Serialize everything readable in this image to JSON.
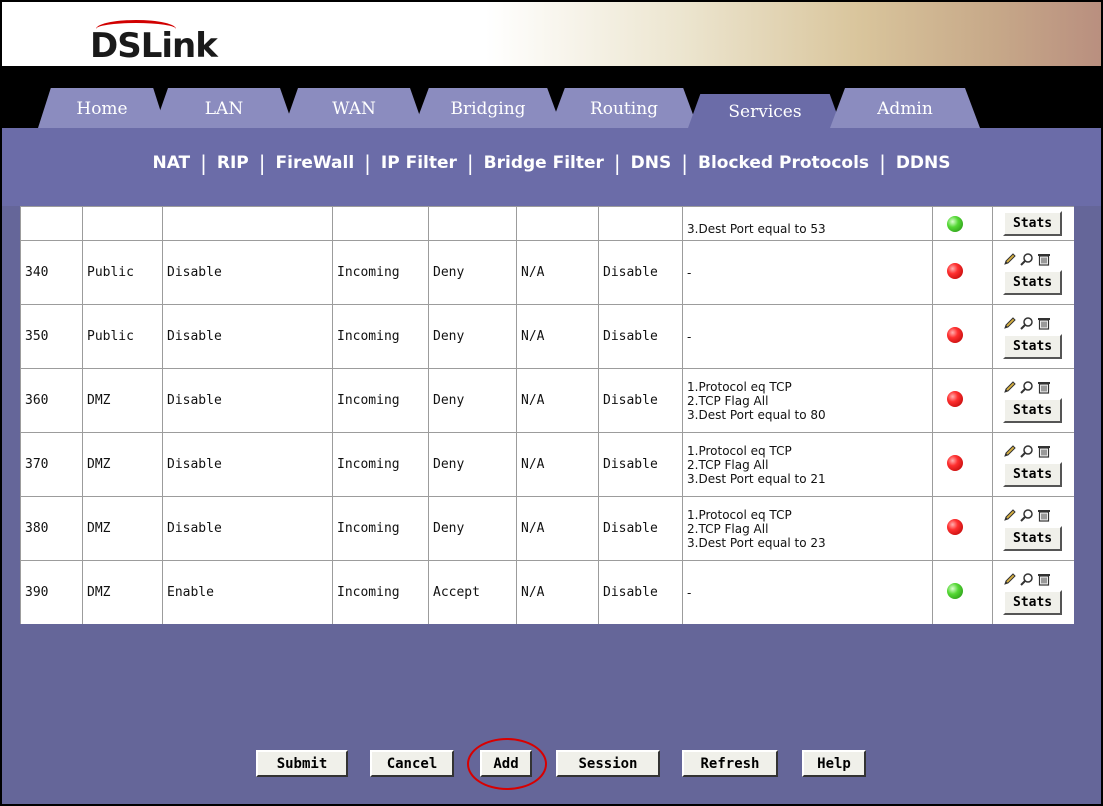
{
  "brand": {
    "logo_text": "DSLink"
  },
  "tabs": [
    {
      "label": "Home"
    },
    {
      "label": "LAN"
    },
    {
      "label": "WAN"
    },
    {
      "label": "Bridging"
    },
    {
      "label": "Routing"
    },
    {
      "label": "Services",
      "active": true
    },
    {
      "label": "Admin"
    }
  ],
  "subnav": [
    {
      "label": "NAT"
    },
    {
      "label": "RIP"
    },
    {
      "label": "FireWall"
    },
    {
      "label": "IP Filter"
    },
    {
      "label": "Bridge Filter"
    },
    {
      "label": "DNS"
    },
    {
      "label": "Blocked Protocols"
    },
    {
      "label": "DDNS"
    }
  ],
  "subnav_separator": "|",
  "partial_row": {
    "filter_tail": "3.Dest Port equal to 53",
    "status": "green",
    "stats_label": "Stats"
  },
  "rows": [
    {
      "id": "340",
      "interface": "Public",
      "enable": "Disable",
      "direction": "Incoming",
      "action": "Deny",
      "a": "N/A",
      "b": "Disable",
      "filter": "-",
      "status": "red",
      "stats_label": "Stats"
    },
    {
      "id": "350",
      "interface": "Public",
      "enable": "Disable",
      "direction": "Incoming",
      "action": "Deny",
      "a": "N/A",
      "b": "Disable",
      "filter": "-",
      "status": "red",
      "stats_label": "Stats"
    },
    {
      "id": "360",
      "interface": "DMZ",
      "enable": "Disable",
      "direction": "Incoming",
      "action": "Deny",
      "a": "N/A",
      "b": "Disable",
      "filter": "1.Protocol eq TCP\n2.TCP Flag All\n3.Dest Port equal to 80",
      "status": "red",
      "stats_label": "Stats"
    },
    {
      "id": "370",
      "interface": "DMZ",
      "enable": "Disable",
      "direction": "Incoming",
      "action": "Deny",
      "a": "N/A",
      "b": "Disable",
      "filter": "1.Protocol eq TCP\n2.TCP Flag All\n3.Dest Port equal to 21",
      "status": "red",
      "stats_label": "Stats"
    },
    {
      "id": "380",
      "interface": "DMZ",
      "enable": "Disable",
      "direction": "Incoming",
      "action": "Deny",
      "a": "N/A",
      "b": "Disable",
      "filter": "1.Protocol eq TCP\n2.TCP Flag All\n3.Dest Port equal to 23",
      "status": "red",
      "stats_label": "Stats"
    },
    {
      "id": "390",
      "interface": "DMZ",
      "enable": "Enable",
      "direction": "Incoming",
      "action": "Accept",
      "a": "N/A",
      "b": "Disable",
      "filter": "-",
      "status": "green",
      "stats_label": "Stats"
    }
  ],
  "row_icons": [
    "edit-pencil-icon",
    "view-magnifier-icon",
    "delete-trash-icon"
  ],
  "buttons": {
    "submit": "Submit",
    "cancel": "Cancel",
    "add": "Add",
    "session": "Session",
    "refresh": "Refresh",
    "help": "Help"
  },
  "colors": {
    "panel": "#656699",
    "tab": "#8b8cbf",
    "highlight_circle": "#d80000"
  }
}
